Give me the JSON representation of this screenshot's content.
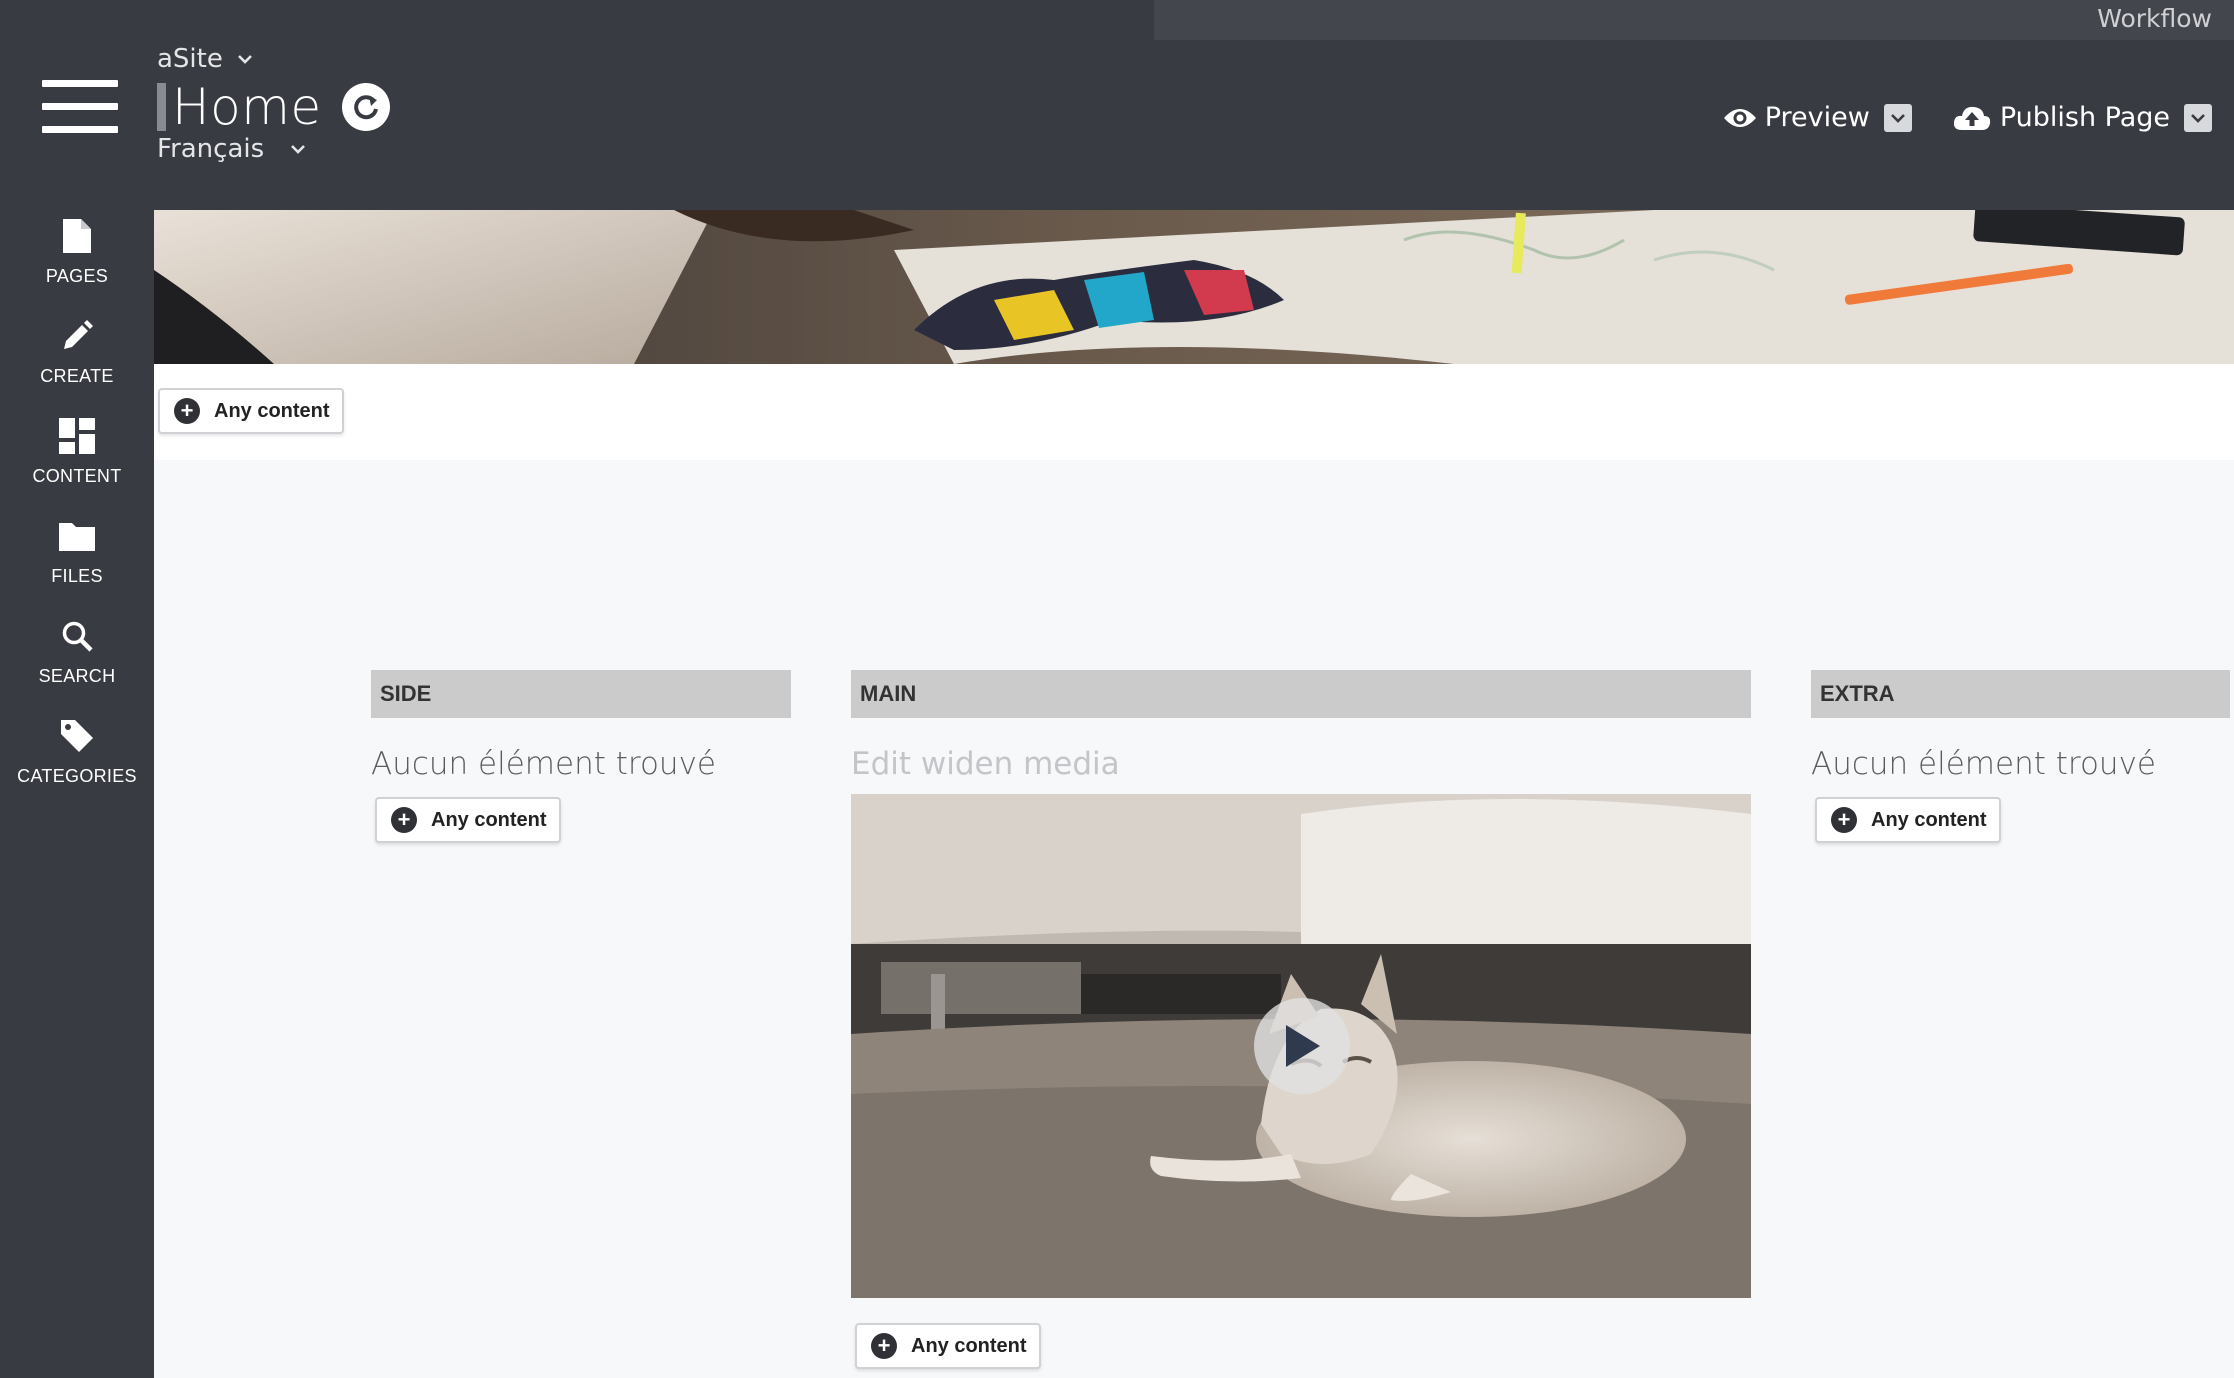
{
  "header": {
    "workflow_label": "Workflow",
    "site_name": "aSite",
    "page_title": "Home",
    "language": "Français",
    "preview_label": "Preview",
    "publish_label": "Publish Page"
  },
  "sidebar": {
    "items": [
      {
        "label": "PAGES",
        "icon": "page-icon"
      },
      {
        "label": "CREATE",
        "icon": "pencil-icon"
      },
      {
        "label": "CONTENT",
        "icon": "dashboard-icon"
      },
      {
        "label": "FILES",
        "icon": "folder-icon"
      },
      {
        "label": "SEARCH",
        "icon": "search-icon"
      },
      {
        "label": "CATEGORIES",
        "icon": "tag-icon"
      }
    ]
  },
  "zones": {
    "top_add_label": "Any content",
    "side": {
      "title": "SIDE",
      "empty_text": "Aucun élément trouvé",
      "add_label": "Any content"
    },
    "main": {
      "title": "MAIN",
      "media_caption": "Edit widen media",
      "add_label": "Any content"
    },
    "extra": {
      "title": "EXTRA",
      "empty_text": "Aucun élément trouvé",
      "add_label": "Any content"
    }
  },
  "colors": {
    "chrome": "#393b42",
    "canvas": "#f7f8fa",
    "zone_header": "#cbcbcc"
  }
}
